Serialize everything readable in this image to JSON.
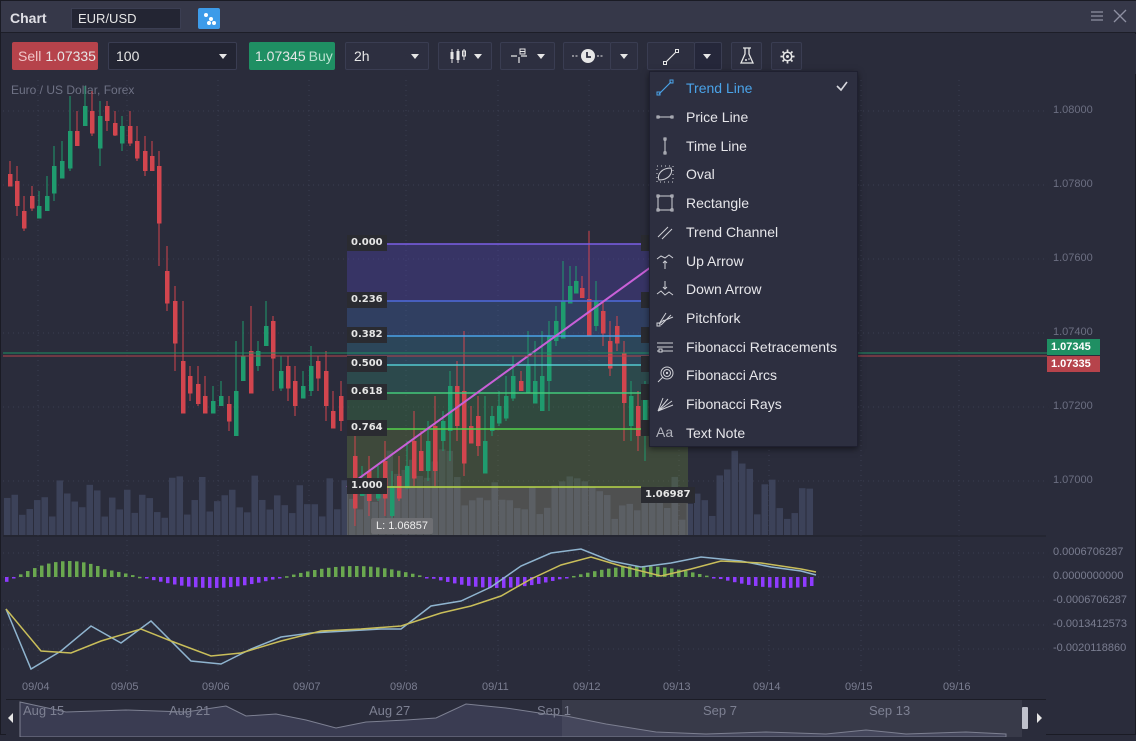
{
  "window": {
    "title": "Chart",
    "symbol": "EUR/USD",
    "link_icon": "link-icon",
    "menu_icon": "hamburger-icon",
    "close_icon": "close-icon"
  },
  "toolbar": {
    "sell": {
      "label": "Sell",
      "price": "1.07335"
    },
    "quantity": "100",
    "buy": {
      "label": "Buy",
      "price": "1.07345"
    },
    "timeframe": "2h",
    "chart_type_icon": "candlestick-icon",
    "crosshair_icon": "crosshair-icon",
    "clock_icon": "clock-icon",
    "draw_tool_icon": "trend-line-icon",
    "indicators_icon": "flask-icon",
    "settings_icon": "gear-icon"
  },
  "chart": {
    "subtitle": "Euro / US Dollar, Forex",
    "price_axis": [
      "1.08000",
      "1.07800",
      "1.07600",
      "1.07400",
      "1.07200",
      "1.07000"
    ],
    "ask_tag": "1.07345",
    "bid_tag": "1.07335",
    "colors": {
      "up": "#1f9b6e",
      "down": "#d2454e",
      "ask": "#1f8f63",
      "bid": "#b6434b",
      "volume": "#3c4259"
    },
    "fibonacci": {
      "levels": [
        "0.000",
        "0.236",
        "0.382",
        "0.500",
        "0.618",
        "0.764",
        "1.000"
      ],
      "end_price": "1.06987",
      "low_label": "L: 1.06857"
    },
    "macd_axis": [
      "0.0006706287",
      "0.0000000000",
      "-0.0006706287",
      "-0.0013412573",
      "-0.0020118860"
    ],
    "dates": [
      "09/04",
      "09/05",
      "09/06",
      "09/07",
      "09/08",
      "09/11",
      "09/12",
      "09/13",
      "09/14",
      "09/15",
      "09/16"
    ],
    "navigator_dates": [
      "Aug 15",
      "Aug 21",
      "Aug 27",
      "Sep 1",
      "Sep 7",
      "Sep 13"
    ]
  },
  "drawing_menu": {
    "items": [
      {
        "label": "Trend Line",
        "icon": "trend-line-icon",
        "selected": true
      },
      {
        "label": "Price Line",
        "icon": "price-line-icon"
      },
      {
        "label": "Time Line",
        "icon": "time-line-icon"
      },
      {
        "label": "Oval",
        "icon": "oval-icon"
      },
      {
        "label": "Rectangle",
        "icon": "rectangle-icon"
      },
      {
        "label": "Trend Channel",
        "icon": "trend-channel-icon"
      },
      {
        "label": "Up Arrow",
        "icon": "up-arrow-icon"
      },
      {
        "label": "Down Arrow",
        "icon": "down-arrow-icon"
      },
      {
        "label": "Pitchfork",
        "icon": "pitchfork-icon"
      },
      {
        "label": "Fibonacci Retracements",
        "icon": "fibonacci-retracements-icon"
      },
      {
        "label": "Fibonacci Arcs",
        "icon": "fibonacci-arcs-icon"
      },
      {
        "label": "Fibonacci Rays",
        "icon": "fibonacci-rays-icon"
      },
      {
        "label": "Text Note",
        "icon": "text-note-icon"
      }
    ]
  }
}
